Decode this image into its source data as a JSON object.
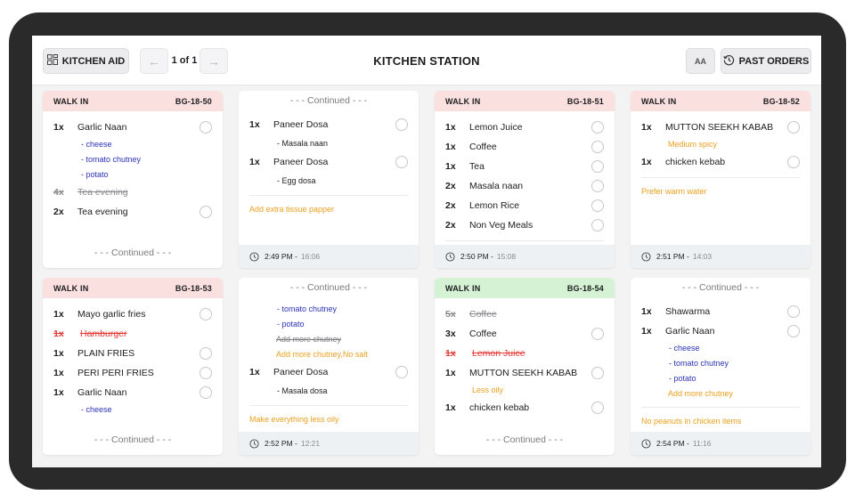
{
  "header": {
    "kitchen_aid_label": "KITCHEN AID",
    "page_indicator": "1 of 1",
    "title": "KITCHEN STATION",
    "font_size_label": "AA",
    "past_orders_label": "PAST ORDERS",
    "prev_icon": "←",
    "next_icon": "→"
  },
  "colors": {
    "header_pending": "#fbe0e0",
    "header_ready": "#d6f2d4",
    "modifier_blue": "#2d33b3",
    "note_orange": "#e8a020",
    "cancelled_red": "#e53935"
  },
  "continued_label": "- - - Continued - - -",
  "orders": [
    {
      "type": "WALK IN",
      "id": "BG-18-50",
      "status": "pending",
      "items": [
        {
          "qty": "1x",
          "name": "Garlic Naan",
          "state": "active",
          "mods": [
            "- cheese",
            "- tomato chutney",
            "- potato"
          ]
        },
        {
          "qty": "4x",
          "name": "Tea evening",
          "state": "struck"
        },
        {
          "qty": "2x",
          "name": "Tea evening",
          "state": "active"
        }
      ],
      "continued_bottom": true
    },
    {
      "continued_top": true,
      "items": [
        {
          "qty": "1x",
          "name": "Paneer Dosa",
          "state": "active",
          "submods": [
            "- Masala naan"
          ]
        },
        {
          "qty": "1x",
          "name": "Paneer Dosa",
          "state": "active",
          "submods": [
            "- Egg dosa"
          ]
        }
      ],
      "note": "Add extra tissue papper",
      "time": "2:49 PM",
      "elapsed": "16:06"
    },
    {
      "type": "WALK IN",
      "id": "BG-18-51",
      "status": "pending",
      "items": [
        {
          "qty": "1x",
          "name": "Lemon Juice",
          "state": "active"
        },
        {
          "qty": "1x",
          "name": "Coffee",
          "state": "active"
        },
        {
          "qty": "1x",
          "name": "Tea",
          "state": "active"
        },
        {
          "qty": "2x",
          "name": "Masala naan",
          "state": "active"
        },
        {
          "qty": "2x",
          "name": "Lemon Rice",
          "state": "active"
        },
        {
          "qty": "2x",
          "name": "Non Veg Meals",
          "state": "active"
        }
      ],
      "time": "2:50 PM",
      "elapsed": "15:08"
    },
    {
      "type": "WALK IN",
      "id": "BG-18-52",
      "status": "pending",
      "items": [
        {
          "qty": "1x",
          "name": "MUTTON SEEKH KABAB",
          "state": "active",
          "notes": [
            "Medium spicy"
          ]
        },
        {
          "qty": "1x",
          "name": "chicken kebab",
          "state": "active"
        }
      ],
      "note": "Prefer warm water",
      "time": "2:51 PM",
      "elapsed": "14:03"
    },
    {
      "type": "WALK IN",
      "id": "BG-18-53",
      "status": "pending",
      "items": [
        {
          "qty": "1x",
          "name": "Mayo garlic fries",
          "state": "active"
        },
        {
          "qty": "1x",
          "name": "Hamburger",
          "state": "cancelled"
        },
        {
          "qty": "1x",
          "name": "PLAIN FRIES",
          "state": "active"
        },
        {
          "qty": "1x",
          "name": "PERI PERI FRIES",
          "state": "active"
        },
        {
          "qty": "1x",
          "name": "Garlic Naan",
          "state": "active",
          "mods": [
            "- cheese"
          ]
        }
      ],
      "continued_bottom": true
    },
    {
      "continued_top": true,
      "leading_mods": [
        "- tomato chutney",
        "- potato"
      ],
      "leading_struck_note": "Add more chutney",
      "leading_note": "Add more chutney,No salt",
      "items": [
        {
          "qty": "1x",
          "name": "Paneer Dosa",
          "state": "active",
          "submods": [
            "- Masala dosa"
          ]
        }
      ],
      "note": "Make everything less oily",
      "time": "2:52 PM",
      "elapsed": "12:21"
    },
    {
      "type": "WALK IN",
      "id": "BG-18-54",
      "status": "ready",
      "items": [
        {
          "qty": "5x",
          "name": "Coffee",
          "state": "struck"
        },
        {
          "qty": "3x",
          "name": "Coffee",
          "state": "active"
        },
        {
          "qty": "1x",
          "name": "Lemon Juice",
          "state": "cancelled"
        },
        {
          "qty": "1x",
          "name": "MUTTON SEEKH KABAB",
          "state": "active",
          "notes": [
            "Less oily"
          ]
        },
        {
          "qty": "1x",
          "name": "chicken kebab",
          "state": "active"
        }
      ],
      "continued_bottom": true
    },
    {
      "continued_top": true,
      "items": [
        {
          "qty": "1x",
          "name": "Shawarma",
          "state": "active"
        },
        {
          "qty": "1x",
          "name": "Garlic Naan",
          "state": "active",
          "mods": [
            "- cheese",
            "- tomato chutney",
            "- potato"
          ],
          "notes": [
            "Add more chutney"
          ]
        }
      ],
      "note": "No peanuts in chicken items",
      "time": "2:54 PM",
      "elapsed": "11:16"
    }
  ]
}
